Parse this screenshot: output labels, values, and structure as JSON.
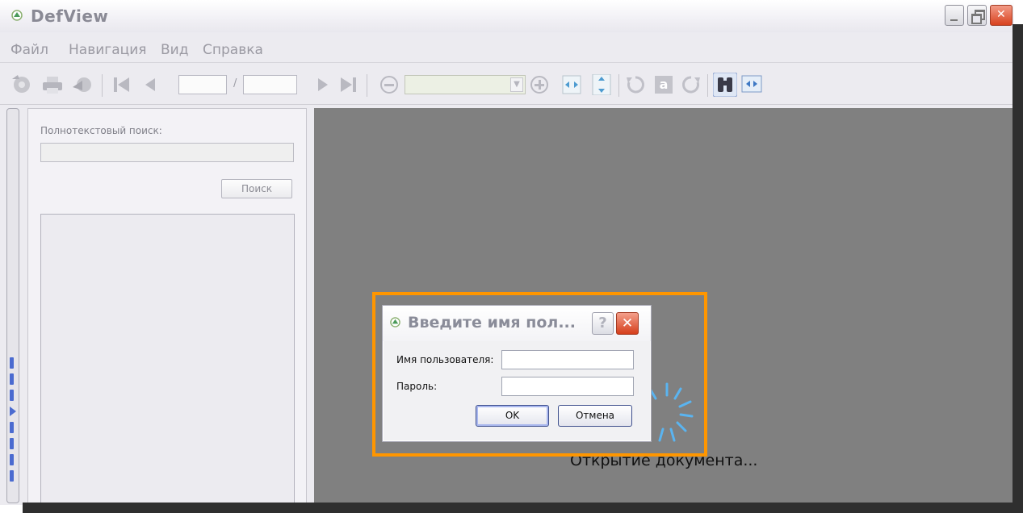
{
  "window": {
    "title": "DefView"
  },
  "menu": {
    "items": [
      "Файл",
      "Навигация",
      "Вид",
      "Справка"
    ]
  },
  "toolbar": {
    "page_separator": "/",
    "current_page": "",
    "total_pages": "",
    "zoom_value": "",
    "rotate_text_glyph": "a"
  },
  "search_panel": {
    "label": "Полнотекстовый поиск:",
    "query": "",
    "button_label": "Поиск"
  },
  "document": {
    "status_text": "Открытие документа..."
  },
  "login_dialog": {
    "title": "Введите имя пол...",
    "help_glyph": "?",
    "username_label": "Имя пользователя:",
    "username_value": "",
    "password_label": "Пароль:",
    "password_value": "",
    "ok_label": "OK",
    "cancel_label": "Отмена"
  },
  "colors": {
    "highlight": "#ff9600",
    "document_background": "#808080",
    "spinner": "#5ab4f0"
  }
}
